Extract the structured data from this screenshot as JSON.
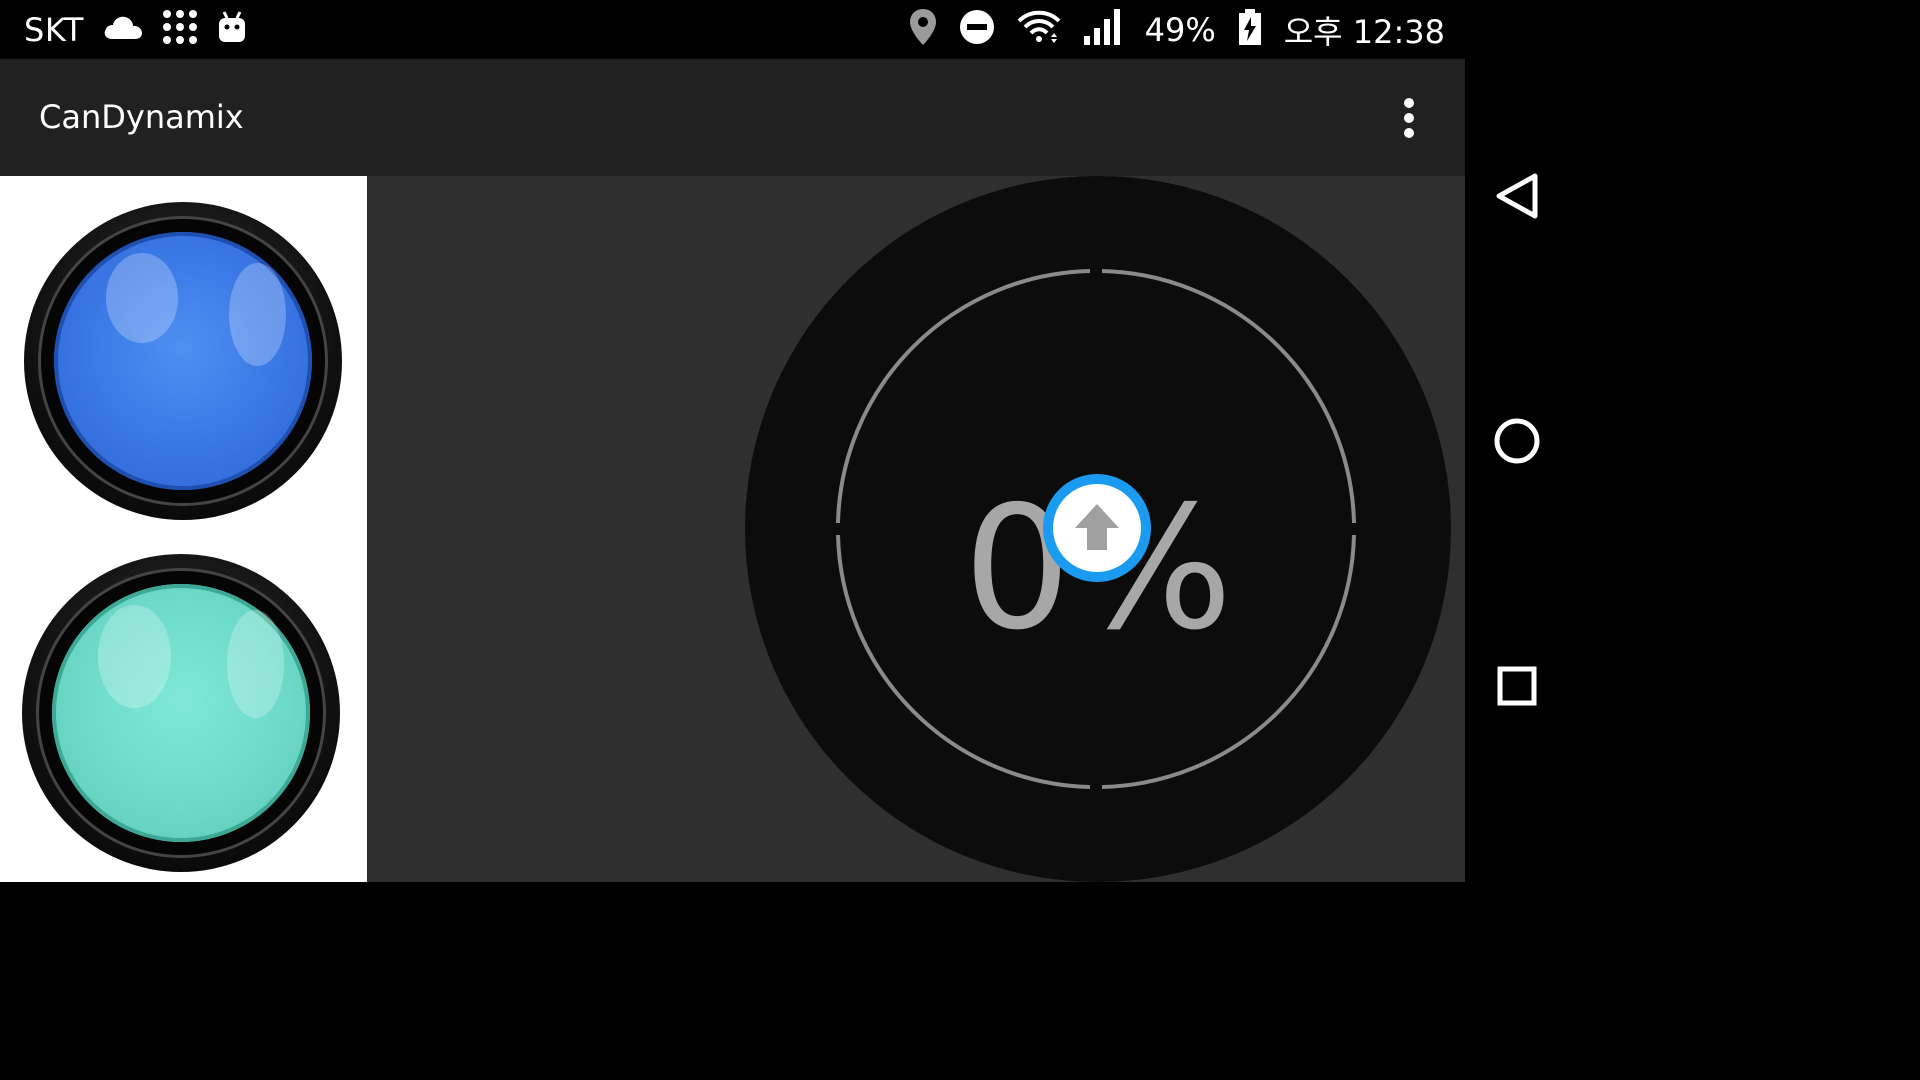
{
  "status_bar": {
    "carrier": "SKT",
    "battery": "49%",
    "time": "오후 12:38",
    "icons": [
      "cloud-icon",
      "apps-grid-icon",
      "android-icon",
      "location-icon",
      "do-not-disturb-icon",
      "wifi-icon",
      "signal-icon",
      "battery-charging-icon"
    ]
  },
  "app_bar": {
    "title": "CanDynamix",
    "menu_icon": "more-vert-icon"
  },
  "buttons": [
    {
      "name": "blue-button",
      "color": "#3a78e6"
    },
    {
      "name": "teal-button",
      "color": "#6edbc9"
    }
  ],
  "gauge": {
    "value_text": "0%",
    "value": 0,
    "knob_icon": "arrow-up-icon",
    "knob_color": "#1a9bf0",
    "ring_color": "#8a8a8a"
  },
  "nav_bar": {
    "icons": [
      "back-icon",
      "home-icon",
      "recents-icon"
    ]
  }
}
